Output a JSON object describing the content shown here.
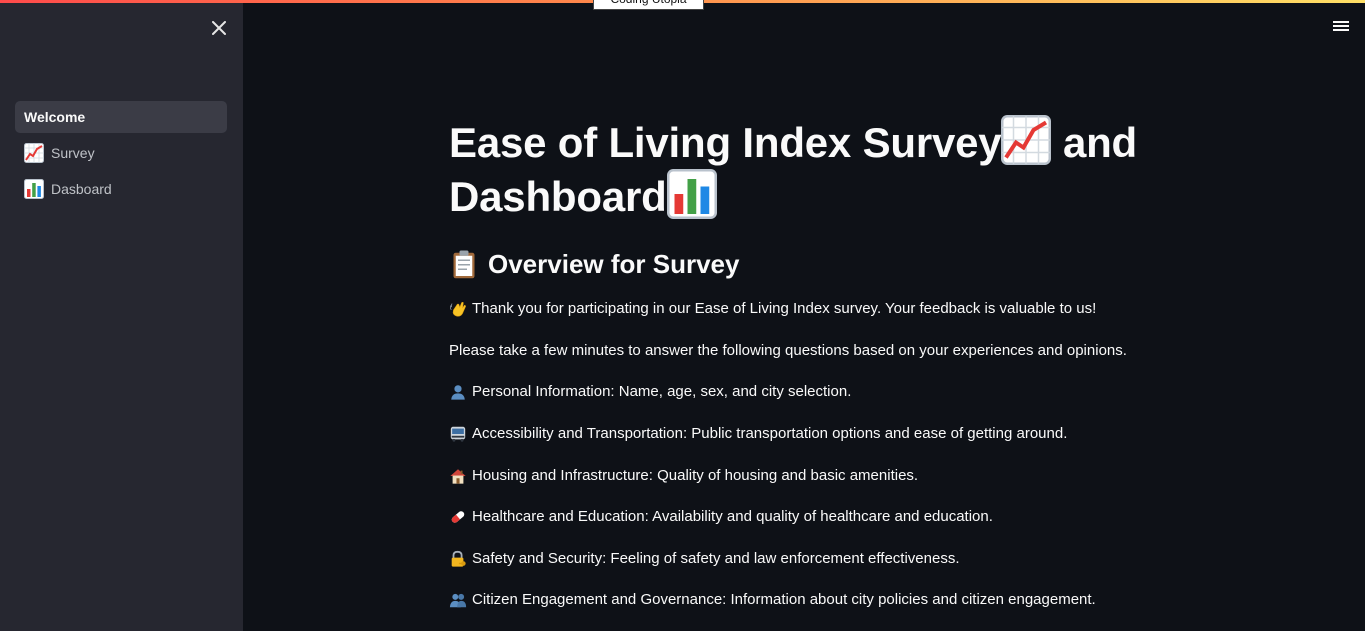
{
  "top_status": {
    "text": "Coding Utopia"
  },
  "sidebar": {
    "close_icon": "close-icon",
    "items": [
      {
        "label": "Welcome",
        "icon": "",
        "active": true
      },
      {
        "label": "Survey",
        "icon": "chart-increasing-icon",
        "active": false
      },
      {
        "label": "Dasboard",
        "icon": "bar-chart-icon",
        "active": false
      }
    ]
  },
  "header": {
    "menu_icon": "hamburger-menu-icon"
  },
  "main": {
    "title_part1": "Ease of Living Index Survey",
    "title_part2": " and",
    "title_part3": "Dashboard",
    "subtitle": "Overview for Survey",
    "paragraphs": [
      {
        "icon": "waving-hand-icon",
        "text": "Thank you for participating in our Ease of Living Index survey. Your feedback is valuable to us!"
      },
      {
        "icon": "",
        "text": "Please take a few minutes to answer the following questions based on your experiences and opinions."
      },
      {
        "icon": "person-icon",
        "text": "Personal Information: Name, age, sex, and city selection."
      },
      {
        "icon": "bus-icon",
        "text": "Accessibility and Transportation: Public transportation options and ease of getting around."
      },
      {
        "icon": "house-icon",
        "text": "Housing and Infrastructure: Quality of housing and basic amenities."
      },
      {
        "icon": "pill-icon",
        "text": "Healthcare and Education: Availability and quality of healthcare and education."
      },
      {
        "icon": "lock-key-icon",
        "text": "Safety and Security: Feeling of safety and law enforcement effectiveness."
      },
      {
        "icon": "people-icon",
        "text": "Citizen Engagement and Governance: Information about city policies and citizen engagement."
      }
    ]
  },
  "colors": {
    "background": "#0e1117",
    "sidebar": "#262730",
    "active_item": "#3b3c46",
    "accent_gradient_start": "#ff4b4b",
    "accent_gradient_end": "#ffe066"
  }
}
